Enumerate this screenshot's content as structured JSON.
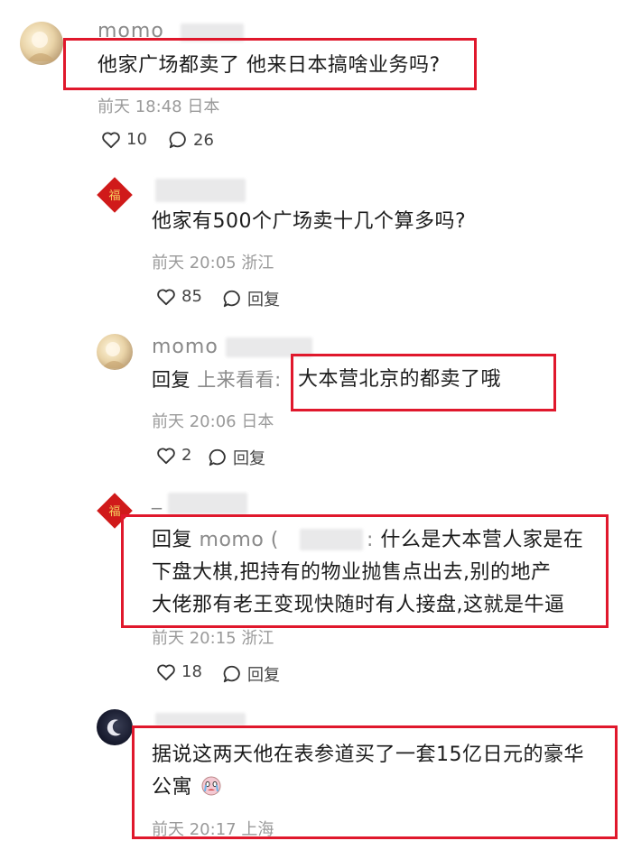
{
  "comments": [
    {
      "username": "momo",
      "text": "他家广场都卖了 他来日本搞啥业务吗?",
      "time": "前天 18:48",
      "location": "日本",
      "likes": "10",
      "replies_count": "26"
    },
    {
      "text": "他家有500个广场卖十几个算多吗?",
      "time": "前天 20:05",
      "location": "浙江",
      "likes": "85",
      "reply_label": "回复"
    },
    {
      "username": "momo",
      "reply_prefix": "回复",
      "reply_to": "上来看看:",
      "text": "大本营北京的都卖了哦",
      "time": "前天 20:06",
      "location": "日本",
      "likes": "2",
      "reply_label": "回复"
    },
    {
      "username": "_",
      "reply_prefix": "回复",
      "reply_to": "momo (",
      "reply_to_tail": ":",
      "text_line1": "什么是大本营人家是在",
      "text_line2": "下盘大棋,把持有的物业抛售点出去,别的地产",
      "text_line3": "大佬那有老王变现快随时有人接盘,这就是牛逼",
      "time": "前天 20:15",
      "location": "浙江",
      "likes": "18",
      "reply_label": "回复"
    },
    {
      "text_line1": "据说这两天他在表参道买了一套15亿日元的豪华",
      "text_line2": "公寓",
      "time": "前天 20:17",
      "location": "上海"
    }
  ],
  "colors": {
    "highlight": "#e0182c",
    "meta": "#9a9a9a",
    "text": "#1c1c1c"
  },
  "icons": {
    "like": "heart-icon",
    "comment": "speech-bubble-icon"
  }
}
